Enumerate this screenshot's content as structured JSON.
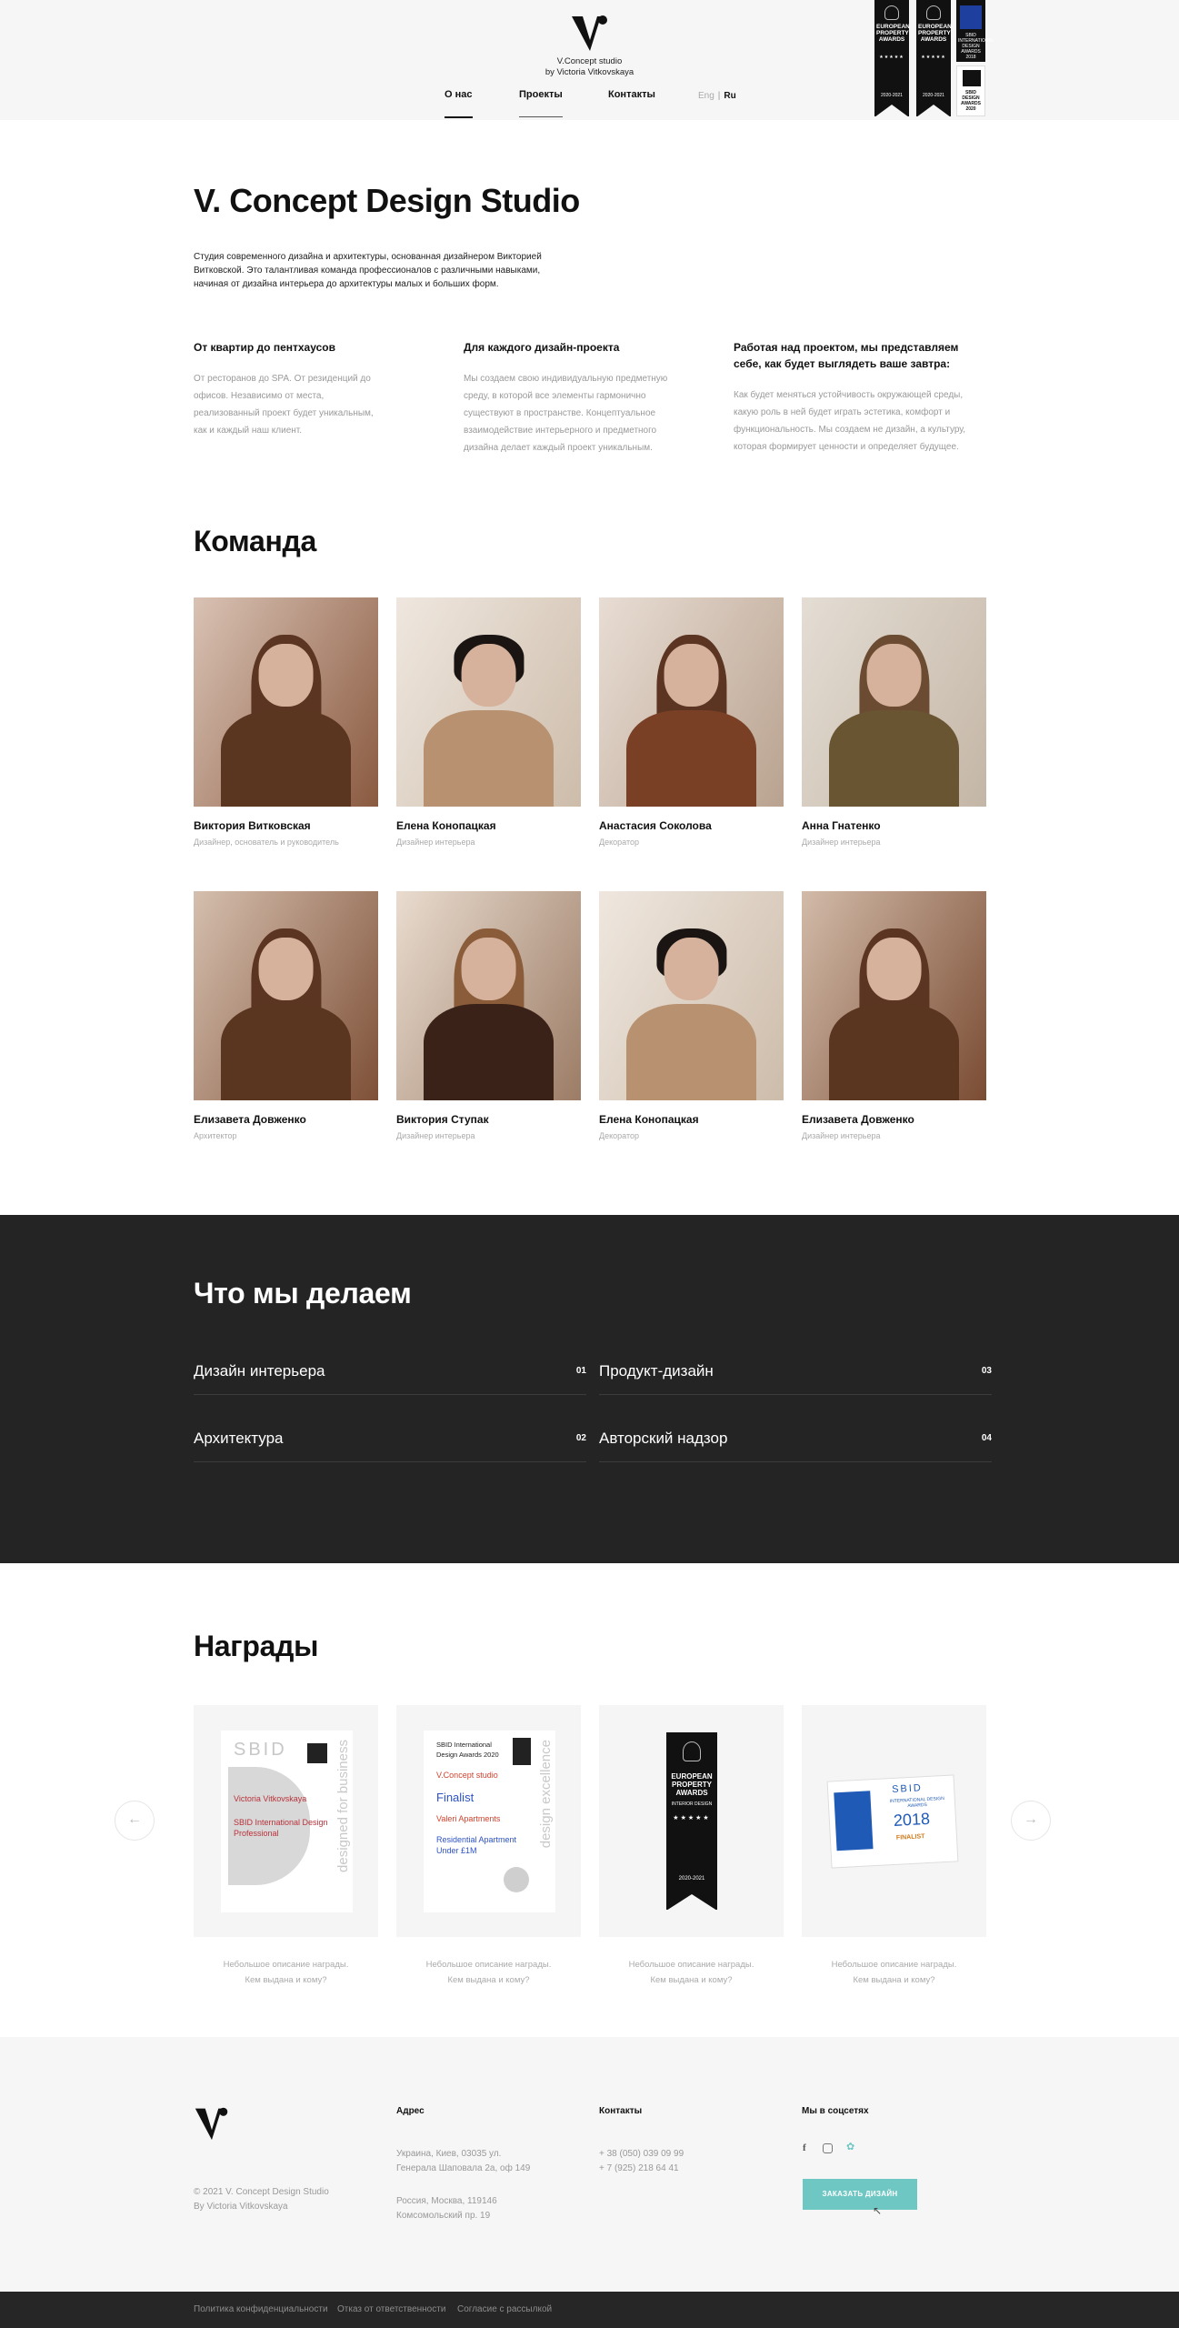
{
  "header": {
    "logo_line1": "V.Concept studio",
    "logo_line2": "by Victoria Vitkovskaya",
    "nav": [
      "О нас",
      "Проекты",
      "Контакты"
    ],
    "lang": {
      "eng": "Eng",
      "ru": "Ru"
    },
    "badges": [
      {
        "text": "EUROPEAN PROPERTY AWARDS",
        "year": "2020-2021"
      },
      {
        "text": "EUROPEAN PROPERTY AWARDS",
        "year": "2020-2021"
      }
    ],
    "sbid_badge": "SBID INTERNATIONAL DESIGN AWARDS 2018",
    "sbid_badge2": "SBID DESIGN AWARDS 2020"
  },
  "intro": {
    "title": "V. Concept Design Studio",
    "text": "Студия современного дизайна и архитектуры, основанная дизайнером Викторией Витковской. Это талантливая команда профессионалов с различными навыками, начиная от дизайна интерьера до архитектуры малых и больших форм.",
    "columns": [
      {
        "title": "От квартир до пентхаусов",
        "text": "От ресторанов до SPA. От резиденций до офисов. Независимо от места, реализованный проект будет уникальным, как и каждый наш клиент."
      },
      {
        "title": "Для каждого дизайн-проекта",
        "text": "Мы создаем свою индивидуальную предметную среду, в которой все элементы гармонично существуют в пространстве. Концептуальное взаимодействие интерьерного и предметного дизайна делает каждый проект уникальным."
      },
      {
        "title": "Работая над проектом, мы представляем себе, как будет выглядеть ваше завтра:",
        "text": "Как будет меняться устойчивость окружающей среды, какую роль в ней будет играть эстетика, комфорт и функциональность. Мы создаем не дизайн, а культуру, которая формирует ценности и определяет будущее."
      }
    ]
  },
  "team": {
    "title": "Команда",
    "members": [
      {
        "name": "Виктория Витковская",
        "role": "Дизайнер, основатель и руководитель"
      },
      {
        "name": "Елена Конопацкая",
        "role": "Дизайнер интерьера"
      },
      {
        "name": "Анастасия Соколова",
        "role": "Декоратор"
      },
      {
        "name": "Анна Гнатенко",
        "role": "Дизайнер интерьера"
      },
      {
        "name": "Елизавета Довженко",
        "role": "Архитектор"
      },
      {
        "name": "Виктория Ступак",
        "role": "Дизайнер интерьера"
      },
      {
        "name": "Елена Конопацкая",
        "role": "Декоратор"
      },
      {
        "name": "Елизавета Довженко",
        "role": "Дизайнер интерьера"
      }
    ]
  },
  "services": {
    "title": "Что мы делаем",
    "items": [
      {
        "label": "Дизайн интерьера",
        "num": "01"
      },
      {
        "label": "Архитектура",
        "num": "02"
      },
      {
        "label": "Продукт-дизайн",
        "num": "03"
      },
      {
        "label": "Авторский надзор",
        "num": "04"
      }
    ]
  },
  "awards": {
    "title": "Награды",
    "desc_line1": "Небольшое описание награды.",
    "desc_line2": "Кем выдана и кому?",
    "cert1": {
      "brand": "SBID",
      "name": "Victoria Vitkovskaya",
      "line1": "SBID International Design",
      "line2": "Professional",
      "vertical": "designed for business"
    },
    "cert2": {
      "head": "SBID International Design Awards 2020",
      "studio": "V.Concept studio",
      "status": "Finalist",
      "project": "Valeri Apartments",
      "category1": "Residential Apartment",
      "category2": "Under £1M",
      "vertical": "design excellence"
    },
    "cert3": {
      "text": "EUROPEAN PROPERTY AWARDS",
      "sub": "INTERIOR DESIGN",
      "year": "2020-2021"
    },
    "cert4": {
      "brand": "SBID",
      "sub": "INTERNATIONAL DESIGN AWARDS",
      "year": "2018",
      "status": "FINALIST"
    }
  },
  "footer": {
    "copy1": "© 2021 V. Concept Design Studio",
    "copy2": "By Victoria Vitkovskaya",
    "address_title": "Адрес",
    "address1a": "Украина, Киев, 03035 ул.",
    "address1b": "Генерала Шаповала 2а, оф 149",
    "address2a": "Россия, Москва, 119146",
    "address2b": "Комсомольский пр. 19",
    "contacts_title": "Контакты",
    "phone1": "+ 38 (050) 039 09 99",
    "phone2": "+ 7 (925) 218 64 41",
    "social_title": "Мы в соцсетях",
    "order_button": "ЗАКАЗАТЬ ДИЗАЙН",
    "links": [
      "Политика конфиденциальности",
      "Отказ от ответственности",
      "Согласие с рассылкой"
    ]
  }
}
